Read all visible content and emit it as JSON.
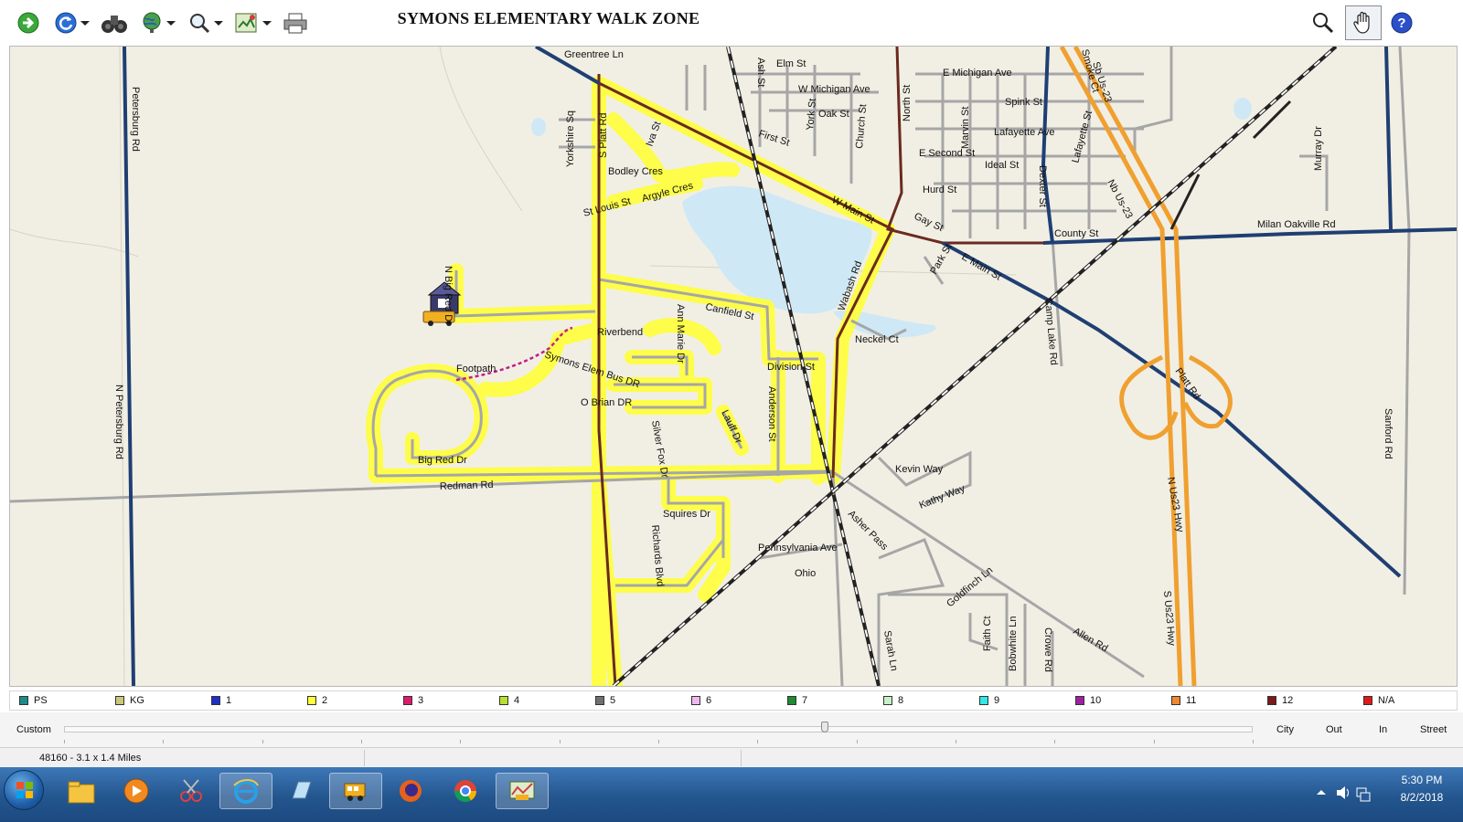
{
  "toolbar": {
    "title": "SYMONS ELEMENTARY WALK ZONE",
    "icons": [
      "go-forward-icon",
      "refresh-icon",
      "binoculars-icon",
      "globe-icon",
      "zoom-icon",
      "map-layers-icon",
      "print-icon",
      "search-icon",
      "pan-hand-icon",
      "help-icon"
    ]
  },
  "map": {
    "scale_text": "48160 - 3.1 x 1.4 Miles",
    "colors": {
      "background": "#f1efe4",
      "local_road": "#a6a6a6",
      "highway": "#1f3f73",
      "arterial": "#6b2a1f",
      "walk_zone": "#ffff3a",
      "freeway": "#f0a030",
      "water": "#cfe8f6"
    },
    "street_labels": {
      "greentree": "Greentree Ln",
      "elm": "Elm St",
      "e_michigan": "E Michigan Ave",
      "w_michigan": "W Michigan Ave",
      "oak": "Oak St",
      "spink": "Spink St",
      "lafayette_ave": "Lafayette Ave",
      "e_second": "E Second St",
      "ideal": "Ideal St",
      "hurd": "Hurd St",
      "first": "First St",
      "w_main": "W Main St",
      "gay": "Gay St",
      "county": "County St",
      "milan_oakville": "Milan Oakville Rd",
      "e_main": "E Main St",
      "park": "Park St",
      "n_petersburg_top": "Petersburg Rd",
      "n_petersburg": "N Petersburg Rd",
      "yorkshire": "Yorkshire Sq",
      "s_platt": "S Platt Rd",
      "iva": "Iva St",
      "bodley": "Bodley Cres",
      "st_louis": "St Louis St",
      "argyle": "Argyle Cres",
      "ash": "Ash St",
      "york": "York St",
      "church": "Church St",
      "north": "North St",
      "marvin": "Marvin St",
      "dexter": "Dexter St",
      "smoke": "Smoke Ct",
      "lafayette_st": "Lafayette St",
      "sb_us23": "Sb Us-23",
      "nb_us23": "Nb Us-23",
      "murray": "Murray Dr",
      "n_big_red": "N Big Red Dr",
      "canfield": "Canfield St",
      "ann_marie": "Ann Marie Dr",
      "riverbend": "Riverbend",
      "wabash": "Wabash Rd",
      "neckel": "Neckel Ct",
      "footpath": "Footpath",
      "symons_bus": "Symons Elem Bus DR",
      "obrian": "O Brian DR",
      "division": "Division St",
      "anderson": "Anderson St",
      "lauff": "Lauff Dr",
      "silver_fox": "Silver Fox Dr",
      "big_red": "Big Red Dr",
      "redman": "Redman Rd",
      "kevin": "Kevin Way",
      "kathy": "Kathy Way",
      "squires": "Squires Dr",
      "richards": "Richards Blvd",
      "asher": "Asher Pass",
      "pennsylvania": "Pennsylvania Ave",
      "ohio": "Ohio",
      "goldfinch": "Goldfinch Ln",
      "faith": "Faith Ct",
      "bobwhite": "Bobwhite Ln",
      "crowe": "Crowe Rd",
      "allen": "Allen Rd",
      "sarah": "Sarah Ln",
      "camp_lake": "Camp Lake Rd",
      "platt_rd": "Platt Rd",
      "n_us23_hwy": "N Us23 Hwy",
      "s_us23_hwy": "S Us23 Hwy",
      "sanford": "Sanford Rd",
      "e_main2": "E Main St"
    }
  },
  "legend": {
    "items": [
      {
        "label": "PS",
        "color": "#1f8a8a"
      },
      {
        "label": "KG",
        "color": "#c8c878"
      },
      {
        "label": "1",
        "color": "#1f2fc8"
      },
      {
        "label": "2",
        "color": "#ffff3a"
      },
      {
        "label": "3",
        "color": "#e0196a"
      },
      {
        "label": "4",
        "color": "#b8e030"
      },
      {
        "label": "5",
        "color": "#707070"
      },
      {
        "label": "6",
        "color": "#f0b8f0"
      },
      {
        "label": "7",
        "color": "#1f8a30"
      },
      {
        "label": "8",
        "color": "#c8f0c8"
      },
      {
        "label": "9",
        "color": "#30e8e8"
      },
      {
        "label": "10",
        "color": "#a020a0"
      },
      {
        "label": "11",
        "color": "#f08830"
      },
      {
        "label": "12",
        "color": "#7a1a1a"
      },
      {
        "label": "N/A",
        "color": "#e01818"
      }
    ]
  },
  "zoom": {
    "custom_label": "Custom",
    "city": "City",
    "out": "Out",
    "in": "In",
    "street": "Street",
    "level": 0.64
  },
  "status": {
    "text": "48160 - 3.1 x 1.4 Miles"
  },
  "taskbar": {
    "apps": [
      "start-button",
      "file-explorer-icon",
      "media-player-icon",
      "snipping-tool-icon",
      "internet-explorer-icon",
      "notepad-icon",
      "bus-routing-app-icon",
      "firefox-icon",
      "chrome-icon",
      "map-app-icon"
    ],
    "time": "5:30 PM",
    "date": "8/2/2018"
  }
}
